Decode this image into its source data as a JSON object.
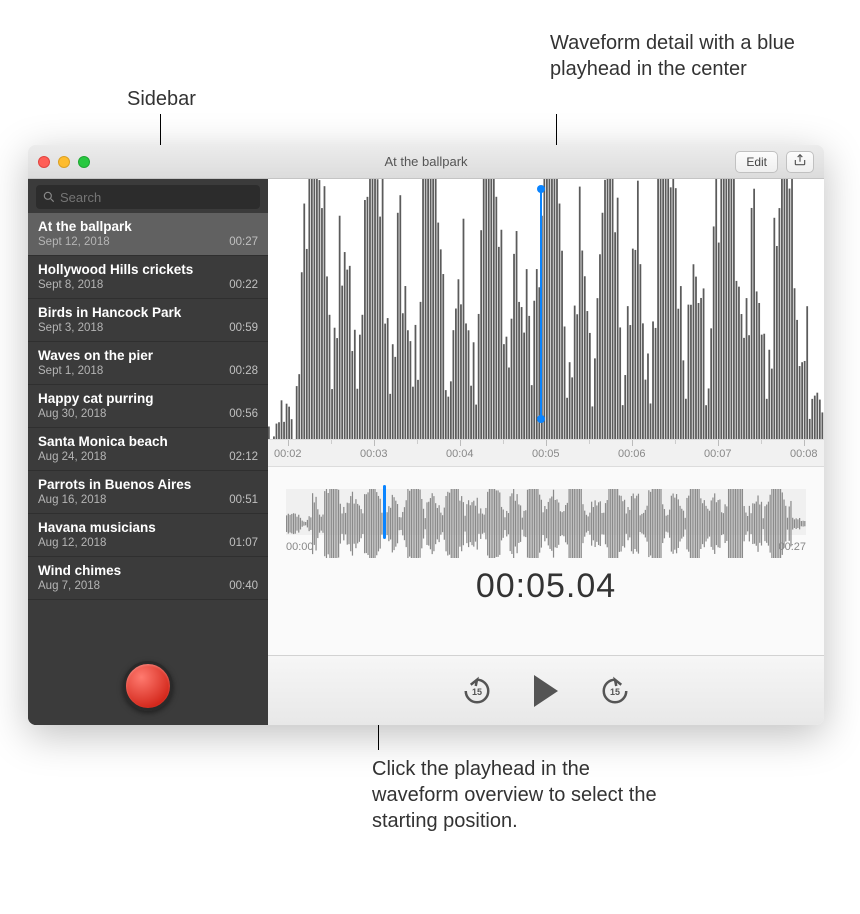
{
  "callouts": {
    "sidebar": "Sidebar",
    "detail": "Waveform detail with a blue playhead in the center",
    "overview": "Click the playhead in the waveform overview to select the starting position."
  },
  "window": {
    "title": "At the ballpark",
    "edit_label": "Edit"
  },
  "search": {
    "placeholder": "Search"
  },
  "recordings": [
    {
      "name": "At the ballpark",
      "date": "Sept 12, 2018",
      "duration": "00:27",
      "selected": true
    },
    {
      "name": "Hollywood Hills crickets",
      "date": "Sept 8, 2018",
      "duration": "00:22",
      "selected": false
    },
    {
      "name": "Birds in Hancock Park",
      "date": "Sept 3, 2018",
      "duration": "00:59",
      "selected": false
    },
    {
      "name": "Waves on the pier",
      "date": "Sept 1, 2018",
      "duration": "00:28",
      "selected": false
    },
    {
      "name": "Happy cat purring",
      "date": "Aug 30, 2018",
      "duration": "00:56",
      "selected": false
    },
    {
      "name": "Santa Monica beach",
      "date": "Aug 24, 2018",
      "duration": "02:12",
      "selected": false
    },
    {
      "name": "Parrots in Buenos Aires",
      "date": "Aug 16, 2018",
      "duration": "00:51",
      "selected": false
    },
    {
      "name": "Havana musicians",
      "date": "Aug 12, 2018",
      "duration": "01:07",
      "selected": false
    },
    {
      "name": "Wind chimes",
      "date": "Aug 7, 2018",
      "duration": "00:40",
      "selected": false
    }
  ],
  "ruler_ticks": [
    "00:02",
    "00:03",
    "00:04",
    "00:05",
    "00:06",
    "00:07",
    "00:08"
  ],
  "overview": {
    "start": "00:00",
    "end": "00:27",
    "playhead_fraction": 0.186
  },
  "current_time": "00:05.04",
  "skip_seconds": "15",
  "colors": {
    "accent": "#0a84ff"
  }
}
